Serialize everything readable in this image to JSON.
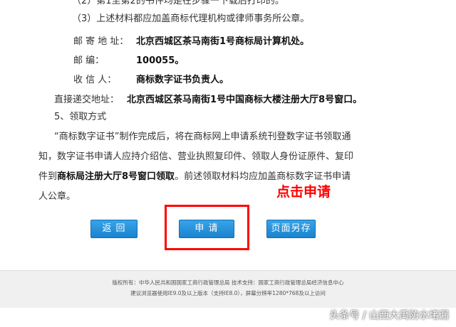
{
  "document": {
    "line1": "（2）第1至第2的书件均是在步骤一下载后打印的。",
    "line2": "（3）上述材料都应加盖商标代理机构或律师事务所公章。",
    "mail_address_label": "邮 寄 地 址：",
    "mail_address_value": "北京西城区茶马南街1号商标局计算机处。",
    "postcode_label": "邮 编：",
    "postcode_value": "100055。",
    "recipient_label": "收 信 人：",
    "recipient_value": "商标数字证书负责人。",
    "direct_label": "直接递交地址：",
    "direct_value": "北京西城区茶马南街1号中国商标大楼注册大厅8号窗口。",
    "section5": "5、领取方式",
    "para_line1": "“商标数字证书”制作完成后，将在商标网上申请系统刊登数字证书领取通",
    "para_line2": "知，数字证书申请人应持介绍信、营业执照复印件、领取人身份证原件、复印",
    "para_line3_a": "件到",
    "para_line3_b": "商标局注册大厅8号窗口领取",
    "para_line3_c": "。前述领取材料均应加盖商标数字证书申请",
    "para_line4": "人公章。"
  },
  "annotation": "点击申请",
  "buttons": {
    "back": "返 回",
    "apply": "申 请",
    "save_as": "页面另存"
  },
  "footer": {
    "line1": "版权所有：中华人民共和国国家工商行政管理总局  技术支持：国家工商行政管理总局经济信息中心",
    "line2": "建议浏览器使用IE9.0及以上版本（支持IE8.0），屏幕分辨率1280*768及以上访问"
  },
  "watermark": "头条号 / 山西大禹防水堵漏"
}
